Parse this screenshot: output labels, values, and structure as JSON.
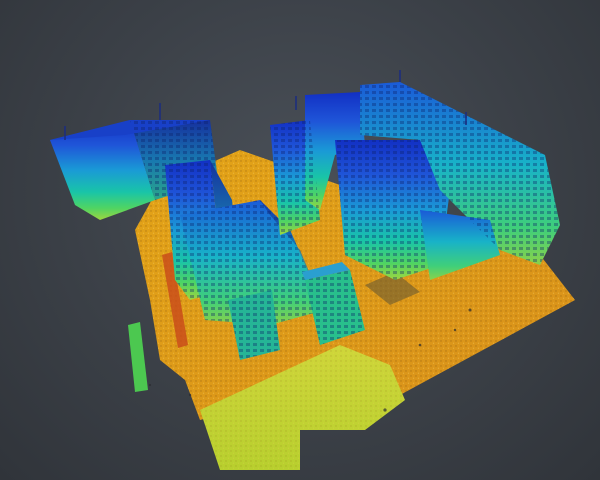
{
  "scene": {
    "type": "point-cloud-viewport",
    "background": "#3b4047",
    "color_mapping": "height",
    "colormap": [
      "#f0a200",
      "#e6c400",
      "#b9d62a",
      "#4fd463",
      "#19b9b0",
      "#1c86d6",
      "#1f4fd8",
      "#1230c4"
    ]
  }
}
